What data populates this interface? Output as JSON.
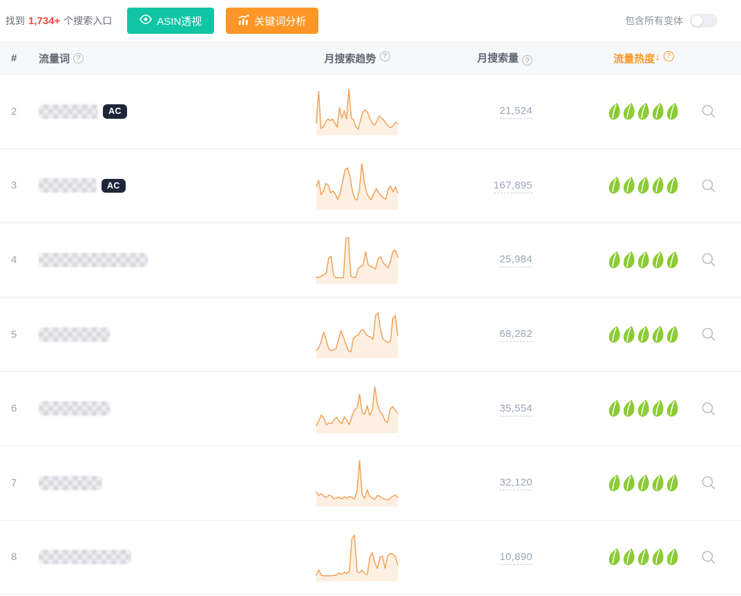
{
  "toolbar": {
    "found_prefix": "找到",
    "found_count": "1,734+",
    "found_suffix": "个搜索入口",
    "asin_button_label": "ASIN透视",
    "keyword_button_label": "关键词分析",
    "variants_toggle_label": "包含所有变体",
    "variants_toggle_state": "off"
  },
  "header": {
    "index": "#",
    "keyword": "流量词",
    "trend": "月搜索趋势",
    "volume": "月搜索量",
    "heat": "流量热度",
    "sort_arrow": "↓",
    "help_glyph": "?"
  },
  "colors": {
    "accent_orange": "#fc9727",
    "accent_teal": "#11c5a4",
    "count_red": "#f5493d",
    "heat_green": "#8ccb35",
    "spark_line": "#f2a055",
    "spark_fill": "#fdf0e2",
    "badge_bg": "#20263a"
  },
  "rows": [
    {
      "index": "2",
      "badge": "AC",
      "volume": "21,524",
      "heat_leaves": 5,
      "blur_width": 86,
      "trend": [
        18,
        95,
        5,
        8,
        20,
        28,
        24,
        28,
        18,
        8,
        55,
        30,
        48,
        28,
        100,
        30,
        26,
        10,
        3,
        25,
        45,
        50,
        44,
        30,
        18,
        13,
        22,
        35,
        30,
        25,
        17,
        10,
        7,
        12,
        20,
        16
      ]
    },
    {
      "index": "3",
      "badge": "AC",
      "volume": "167,895",
      "heat_leaves": 5,
      "blur_width": 84,
      "trend": [
        45,
        60,
        25,
        35,
        52,
        48,
        30,
        34,
        26,
        14,
        30,
        58,
        85,
        90,
        72,
        35,
        16,
        12,
        38,
        100,
        58,
        30,
        18,
        13,
        28,
        40,
        30,
        24,
        17,
        14,
        38,
        46,
        32,
        44,
        30
      ]
    },
    {
      "index": "4",
      "badge": null,
      "volume": "25,984",
      "heat_leaves": 5,
      "blur_width": 158,
      "trend": [
        4,
        4,
        7,
        10,
        14,
        50,
        55,
        9,
        3,
        3,
        3,
        4,
        98,
        100,
        6,
        4,
        4,
        26,
        30,
        34,
        66,
        34,
        30,
        28,
        24,
        48,
        54,
        40,
        33,
        27,
        42,
        66,
        70,
        52
      ]
    },
    {
      "index": "5",
      "badge": null,
      "volume": "68,282",
      "heat_leaves": 5,
      "blur_width": 103,
      "trend": [
        8,
        14,
        30,
        52,
        34,
        12,
        7,
        9,
        12,
        34,
        55,
        40,
        22,
        7,
        4,
        36,
        42,
        45,
        55,
        58,
        48,
        42,
        40,
        34,
        92,
        98,
        58,
        36,
        30,
        27,
        30,
        85,
        92,
        44
      ]
    },
    {
      "index": "6",
      "badge": null,
      "volume": "35,554",
      "heat_leaves": 5,
      "blur_width": 103,
      "trend": [
        6,
        18,
        32,
        24,
        8,
        13,
        11,
        21,
        26,
        17,
        11,
        27,
        19,
        9,
        29,
        44,
        48,
        82,
        38,
        34,
        54,
        31,
        44,
        100,
        58,
        40,
        34,
        17,
        14,
        46,
        52,
        44,
        36
      ]
    },
    {
      "index": "7",
      "badge": null,
      "volume": "32,120",
      "heat_leaves": 5,
      "blur_width": 92,
      "trend": [
        24,
        16,
        20,
        14,
        11,
        17,
        14,
        8,
        10,
        12,
        8,
        13,
        9,
        14,
        11,
        7,
        28,
        100,
        18,
        9,
        30,
        14,
        9,
        7,
        16,
        14,
        9,
        7,
        5,
        9,
        14,
        17,
        11
      ]
    },
    {
      "index": "8",
      "badge": null,
      "volume": "10,890",
      "heat_leaves": 5,
      "blur_width": 134,
      "trend": [
        4,
        16,
        3,
        2,
        2,
        2,
        2,
        3,
        4,
        9,
        5,
        11,
        7,
        14,
        92,
        100,
        13,
        9,
        16,
        7,
        5,
        46,
        58,
        33,
        20,
        46,
        50,
        20,
        50,
        56,
        54,
        50,
        28
      ]
    }
  ]
}
